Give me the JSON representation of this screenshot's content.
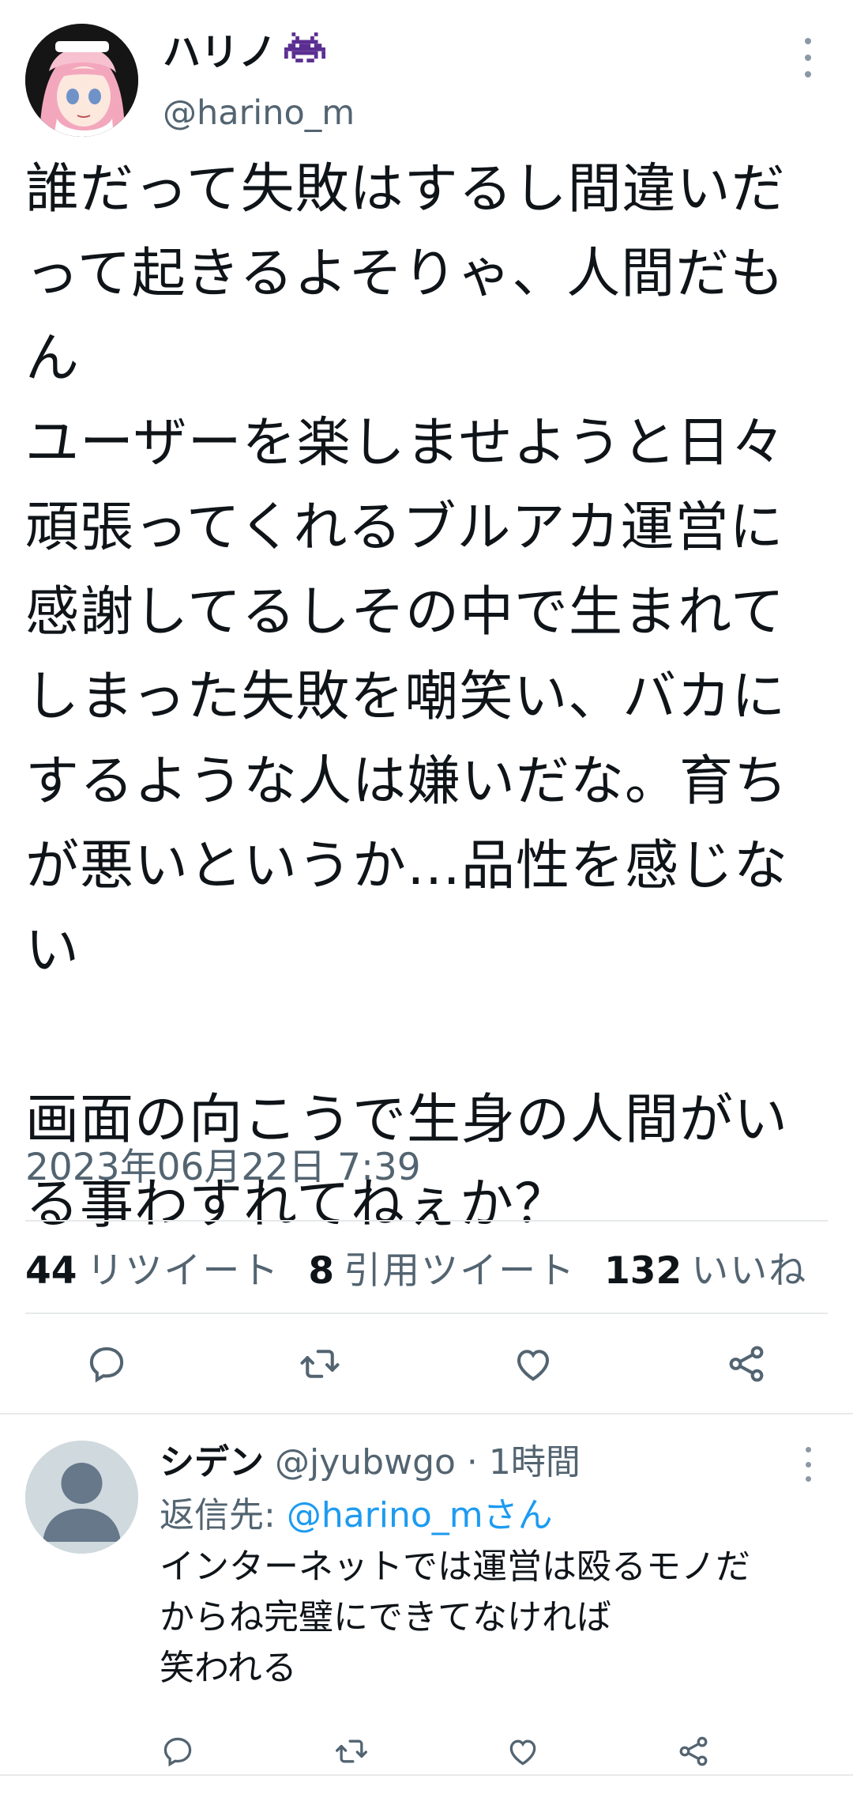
{
  "tweet": {
    "display_name": "ハリノ",
    "name_emoji": "space-invader-icon",
    "handle": "@harino_m",
    "text": "誰だって失敗はするし間違いだ\nって起きるよそりゃ、人間だも\nん\nユーザーを楽しませようと日々\n頑張ってくれるブルアカ運営に\n感謝してるしその中で生まれて\nしまった失敗を嘲笑い、バカに\nするような人は嫌いだな。育ち\nが悪いというか…品性を感じない\n\n画面の向こうで生身の人間がい\nる事わすれてねぇか？",
    "timestamp": "2023年06月22日 7:39",
    "stats": {
      "retweets": "44",
      "retweets_label": "リツイート",
      "quotes": "8",
      "quotes_label": "引用ツイート",
      "likes": "132",
      "likes_label": "いいね"
    }
  },
  "reply": {
    "display_name": "シデン",
    "handle_time": "@jyubwgo · 1時間",
    "reply_to_label": "返信先: ",
    "reply_to_handle": "@harino_mさん",
    "text": "インターネットでは運営は殴るモノだ\nからね完璧にできてなければ\n笑われる"
  },
  "colors": {
    "text": "#0f1419",
    "secondary": "#536471",
    "link": "#1d9bf0",
    "divider": "#e7e9ea",
    "emoji": "#5b2e91"
  }
}
